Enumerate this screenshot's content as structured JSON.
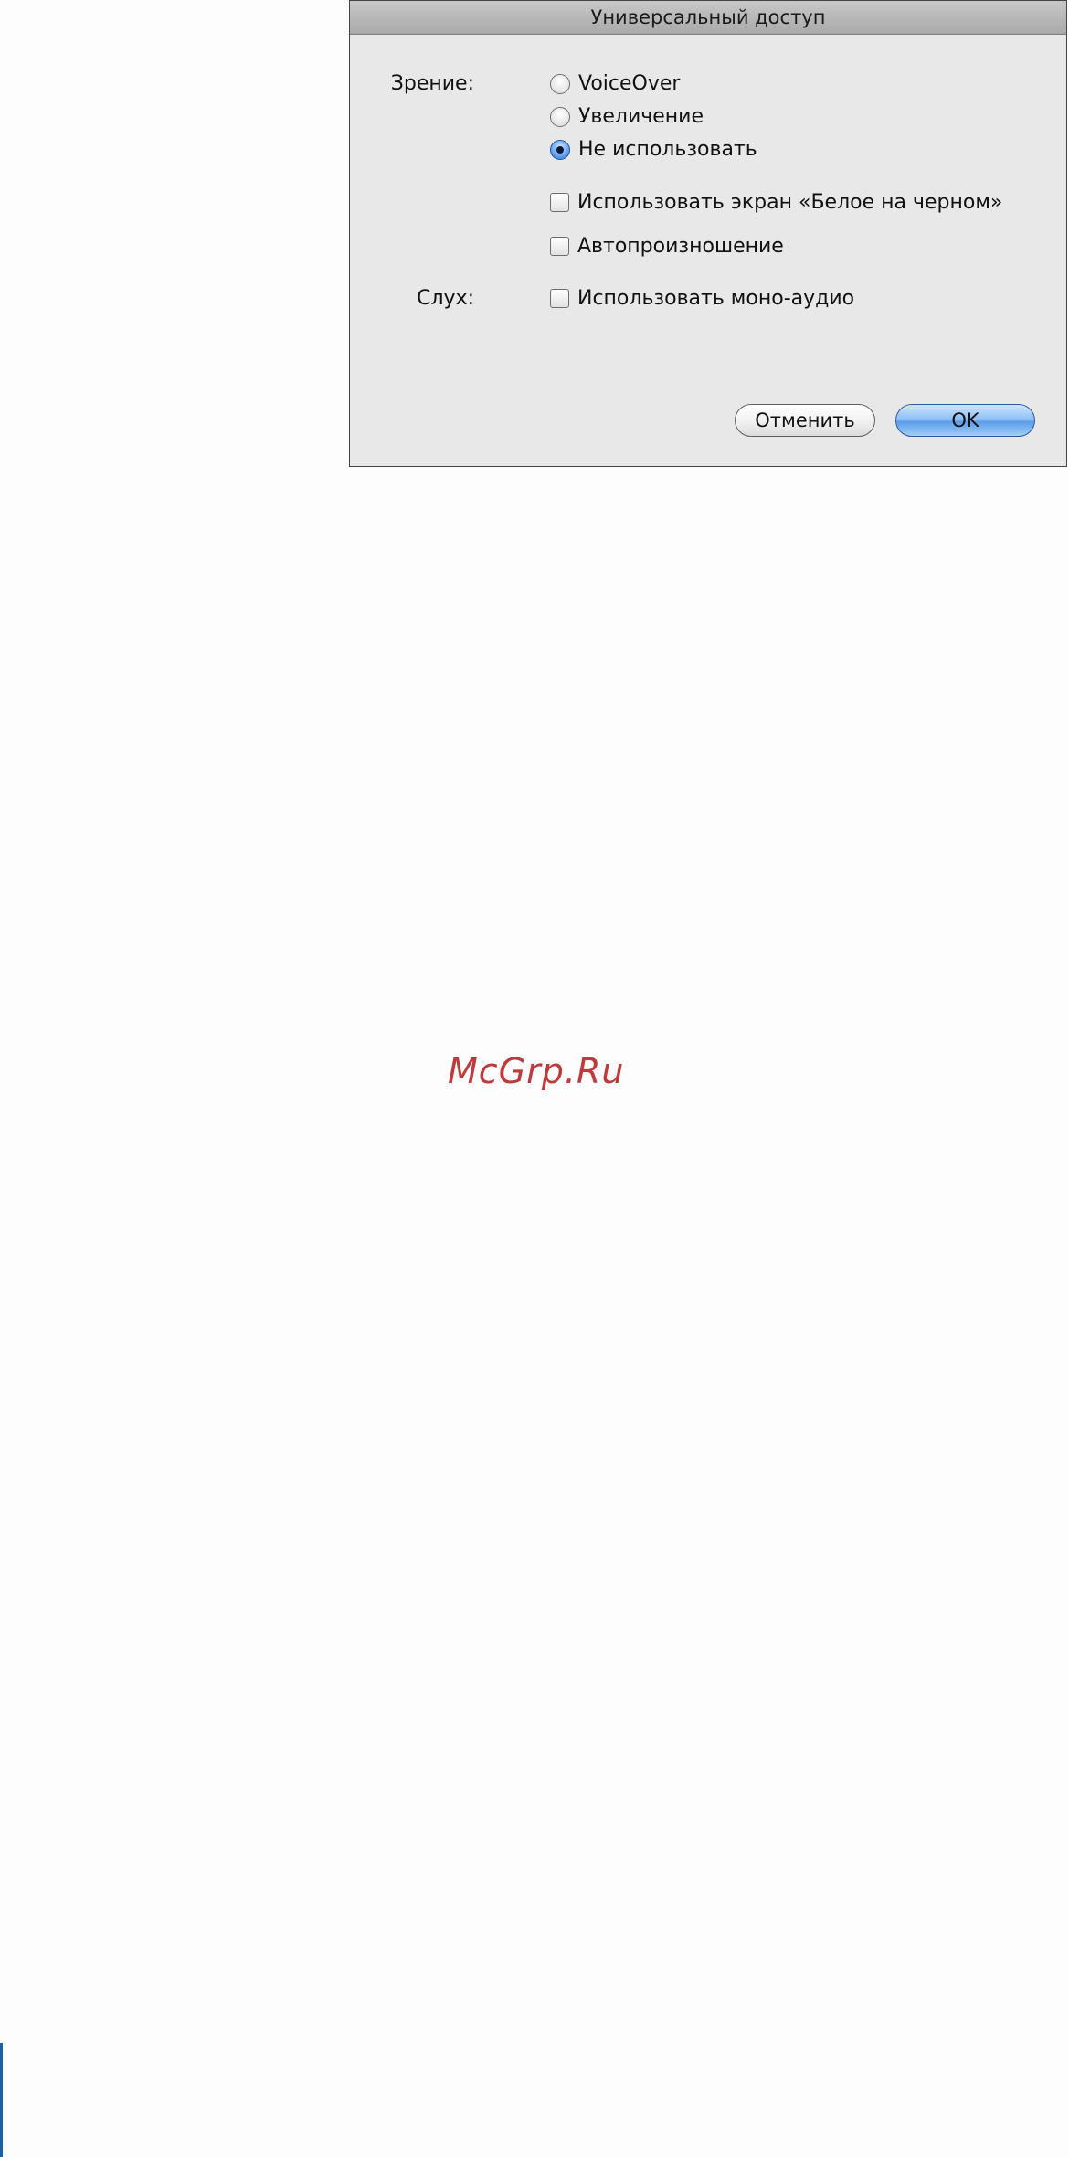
{
  "dialog": {
    "title": "Универсальный доступ",
    "vision": {
      "label": "Зрение:",
      "options": [
        {
          "label": "VoiceOver",
          "selected": false
        },
        {
          "label": "Увеличение",
          "selected": false
        },
        {
          "label": "Не использовать",
          "selected": true
        }
      ],
      "checkboxes": [
        {
          "label": "Использовать экран «Белое на черном»",
          "checked": false
        },
        {
          "label": "Автопроизношение",
          "checked": false
        }
      ]
    },
    "hearing": {
      "label": "Слух:",
      "checkbox": {
        "label": "Использовать моно-аудио",
        "checked": false
      }
    },
    "buttons": {
      "cancel": "Отменить",
      "ok": "OK"
    }
  },
  "watermark": "McGrp.Ru",
  "colors": {
    "dialog_bg": "#e8e8e8",
    "default_button": "#5c9ce6",
    "watermark": "#c0393b",
    "page_rule": "#1f5fa8"
  }
}
